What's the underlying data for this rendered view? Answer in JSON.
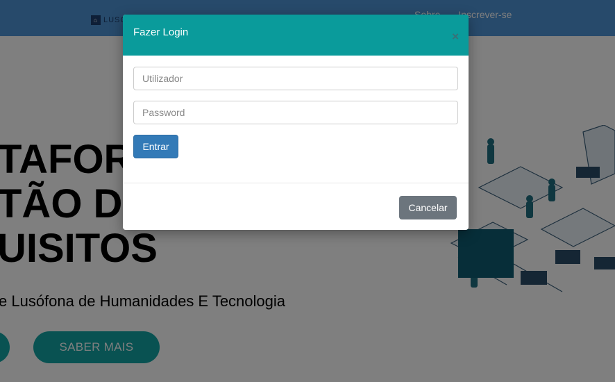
{
  "header": {
    "logo_text": "LUSÓ",
    "nav": {
      "about": "Sobre",
      "signup": "Inscrever-se"
    }
  },
  "hero": {
    "title": "TAFOR\nTÃO D\nUISITOS",
    "subtitle": "e Lusófona de Humanidades E Tecnologia",
    "cta": "SABER MAIS"
  },
  "modal": {
    "title": "Fazer Login",
    "close_symbol": "×",
    "username_placeholder": "Utilizador",
    "password_placeholder": "Password",
    "submit_label": "Entrar",
    "cancel_label": "Cancelar"
  },
  "colors": {
    "topbar": "#4f95d6",
    "modal_header": "#0a9b9b",
    "primary": "#337ab7",
    "secondary": "#6c757d",
    "accent": "#13a4a4"
  }
}
